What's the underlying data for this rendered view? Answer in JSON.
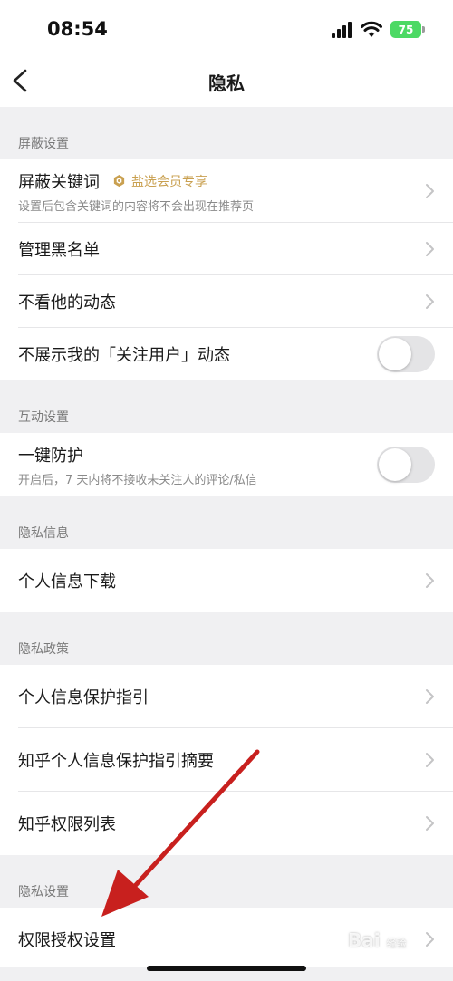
{
  "status_bar": {
    "time": "08:54",
    "battery": "75"
  },
  "nav": {
    "title": "隐私"
  },
  "sections": {
    "block": {
      "header": "屏蔽设置",
      "keywords": {
        "title": "屏蔽关键词",
        "badge": "盐选会员专享",
        "subtitle": "设置后包含关键词的内容将不会出现在推荐页"
      },
      "blacklist": {
        "title": "管理黑名单"
      },
      "hide_his": {
        "title": "不看他的动态"
      },
      "hide_follow": {
        "title": "不展示我的「关注用户」动态",
        "enabled": false
      }
    },
    "interaction": {
      "header": "互动设置",
      "protect": {
        "title": "一键防护",
        "subtitle": "开启后，7 天内将不接收未关注人的评论/私信",
        "enabled": false
      }
    },
    "info": {
      "header": "隐私信息",
      "download": {
        "title": "个人信息下载"
      }
    },
    "policy": {
      "header": "隐私政策",
      "guide": {
        "title": "个人信息保护指引"
      },
      "summary": {
        "title": "知乎个人信息保护指引摘要"
      },
      "permissions": {
        "title": "知乎权限列表"
      }
    },
    "settings": {
      "header": "隐私设置",
      "authorization": {
        "title": "权限授权设置"
      }
    }
  },
  "watermark": {
    "text": "Bai",
    "sub": "经验"
  },
  "colors": {
    "accent_gold": "#c9a050",
    "arrow_red": "#c8201e",
    "battery_green": "#4cd964"
  }
}
